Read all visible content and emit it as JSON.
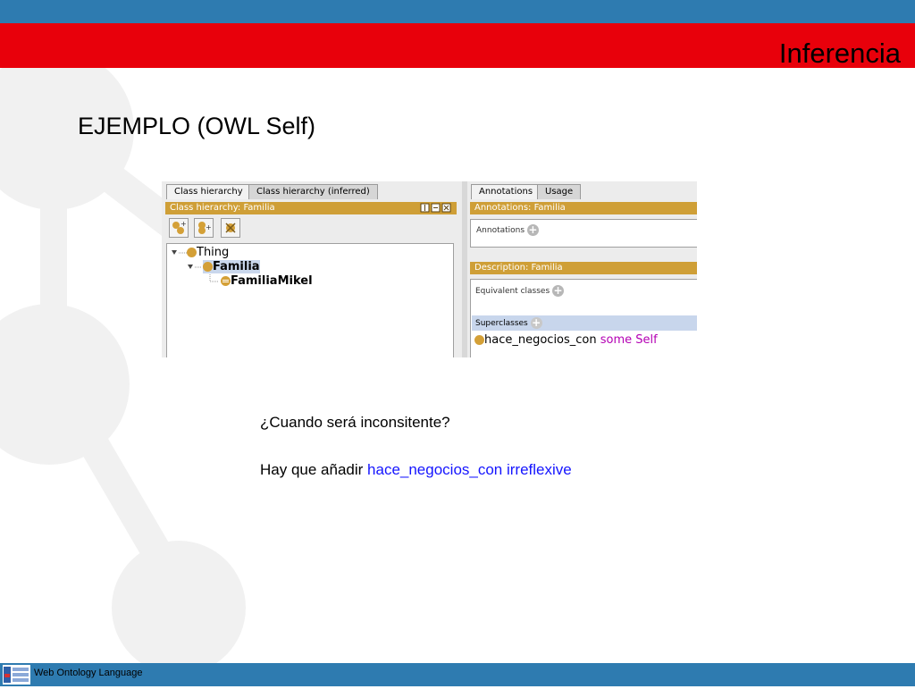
{
  "slide": {
    "title": "Inferencia",
    "heading": "EJEMPLO (OWL Self)",
    "question": "¿Cuando será inconsitente?",
    "answer_prefix": "Hay que añadir ",
    "answer_highlight": "hace_negocios_con irreflexive",
    "footer": "Web Ontology Language"
  },
  "protege": {
    "left_tabs": [
      "Class hierarchy",
      "Class hierarchy (inferred)"
    ],
    "class_hierarchy_header": "Class hierarchy: Familia",
    "tree": [
      "Thing",
      "Familia",
      "FamiliaMikel"
    ],
    "right_tabs": [
      "Annotations",
      "Usage"
    ],
    "annotations_header": "Annotations: Familia",
    "annotations_label": "Annotations",
    "description_header": "Description: Familia",
    "equivalent_label": "Equivalent classes",
    "superclasses_label": "Superclasses",
    "superclass_property": "hace_negocios_con",
    "superclass_restriction": "some Self"
  },
  "colors": {
    "top_blue": "#2e7bb0",
    "title_red": "#e8000b",
    "protege_gold": "#cf9f37",
    "highlight_blue": "#1515ff",
    "keyword_purple": "#b400b4"
  }
}
